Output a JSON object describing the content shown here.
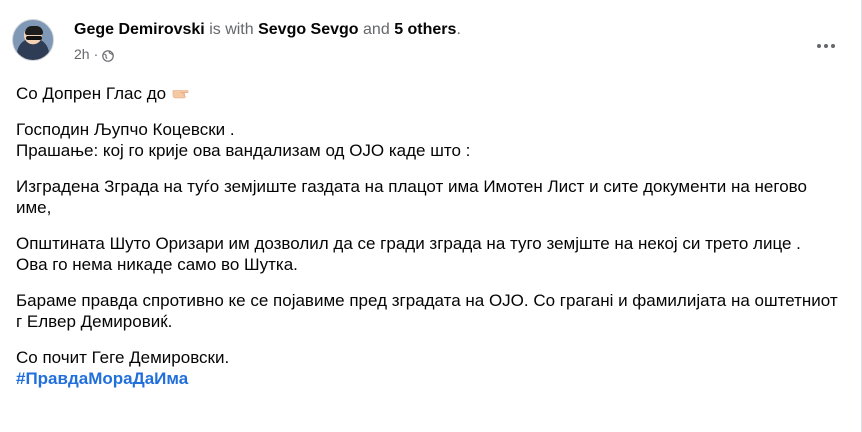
{
  "post": {
    "author": "Gege Demirovski",
    "with_text": "is with",
    "tagged": "Sevgo Sevgo",
    "and_text": "and",
    "others": "5 others",
    "period": ".",
    "time": "2h",
    "separator": "·",
    "audience_icon": "globe-icon",
    "more_icon": "more-options-icon",
    "lines": {
      "p1": "Со Допрен Глас до",
      "p1_emoji": "pointing-down-hand-emoji",
      "p2a": "Господин Љупчо Коцевски .",
      "p2b": "Прашање: кој го крије ова вандализам од ОЈО каде што :",
      "p3": "Изградена Зграда на туѓо земјиште газдата на плацот има Имотен Лист и  сите документи на негово име,",
      "p4a": "Општината Шуто Оризари им дозволил да се гради зграда на туго земјште на некој си трето лице .",
      "p4b": "Ова го нема никаде само во Шутка.",
      "p5": "Бараме правда спротивно ке се појавиме пред зградата на ОЈО. Со граганi и фамилијата на оштетниот г Елвер Демировиќ.",
      "p6": "Со почит Геге Демировски.",
      "hashtag": "#ПравдаМораДаИма"
    }
  },
  "colors": {
    "text": "#050505",
    "muted": "#65676b",
    "link": "#216fdb"
  }
}
